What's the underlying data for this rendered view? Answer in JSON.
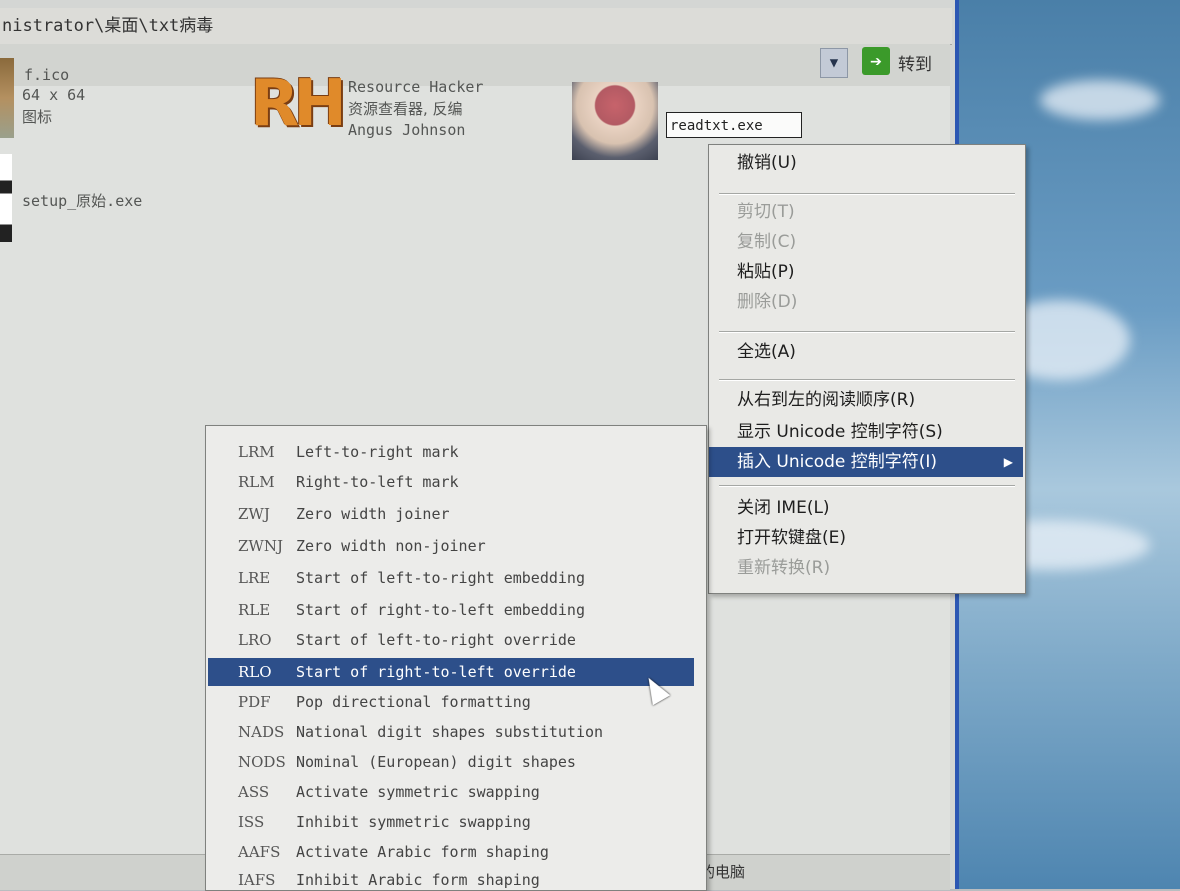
{
  "window": {
    "title": "nistrator\\桌面\\txt病毒"
  },
  "addressbar": {
    "goto_label": "转到",
    "dropdown_icon": "chevron-down-icon",
    "goto_icon": "arrow-right-icon"
  },
  "files": [
    {
      "name": "f.ico",
      "line2": "64 x 64",
      "line3": "图标"
    },
    {
      "name": "Resource Hacker",
      "line2": "资源查看器, 反编",
      "line3": "Angus Johnson"
    },
    {
      "name": "setup_原始.exe"
    }
  ],
  "rename": {
    "value": "readtxt.exe"
  },
  "statusbar": {
    "text": "我的电脑"
  },
  "context_menu": {
    "items": [
      {
        "label": "撤销(U)",
        "enabled": true
      },
      {
        "label": "剪切(T)",
        "enabled": false
      },
      {
        "label": "复制(C)",
        "enabled": false
      },
      {
        "label": "粘贴(P)",
        "enabled": true
      },
      {
        "label": "删除(D)",
        "enabled": false
      },
      {
        "label": "全选(A)",
        "enabled": true
      },
      {
        "label": "从右到左的阅读顺序(R)",
        "enabled": true
      },
      {
        "label": "显示 Unicode 控制字符(S)",
        "enabled": true
      },
      {
        "label": "插入 Unicode 控制字符(I)",
        "enabled": true,
        "highlighted": true
      },
      {
        "label": "关闭 IME(L)",
        "enabled": true
      },
      {
        "label": "打开软键盘(E)",
        "enabled": true
      },
      {
        "label": "重新转换(R)",
        "enabled": false
      }
    ]
  },
  "unicode_submenu": {
    "items": [
      {
        "code": "LRM",
        "desc": "Left-to-right mark"
      },
      {
        "code": "RLM",
        "desc": "Right-to-left mark"
      },
      {
        "code": "ZWJ",
        "desc": "Zero width joiner"
      },
      {
        "code": "ZWNJ",
        "desc": "Zero width non-joiner"
      },
      {
        "code": "LRE",
        "desc": "Start of left-to-right embedding"
      },
      {
        "code": "RLE",
        "desc": "Start of right-to-left embedding"
      },
      {
        "code": "LRO",
        "desc": "Start of left-to-right override"
      },
      {
        "code": "RLO",
        "desc": "Start of right-to-left override",
        "highlighted": true
      },
      {
        "code": "PDF",
        "desc": "Pop directional formatting"
      },
      {
        "code": "NADS",
        "desc": "National digit shapes substitution"
      },
      {
        "code": "NODS",
        "desc": "Nominal (European) digit shapes"
      },
      {
        "code": "ASS",
        "desc": "Activate symmetric swapping"
      },
      {
        "code": "ISS",
        "desc": "Inhibit symmetric swapping"
      },
      {
        "code": "AAFS",
        "desc": "Activate Arabic form shaping"
      },
      {
        "code": "IAFS",
        "desc": "Inhibit Arabic form shaping"
      }
    ]
  },
  "colors": {
    "highlight": "#2d4f8a",
    "desktop_sky": "#6b9dc4"
  }
}
